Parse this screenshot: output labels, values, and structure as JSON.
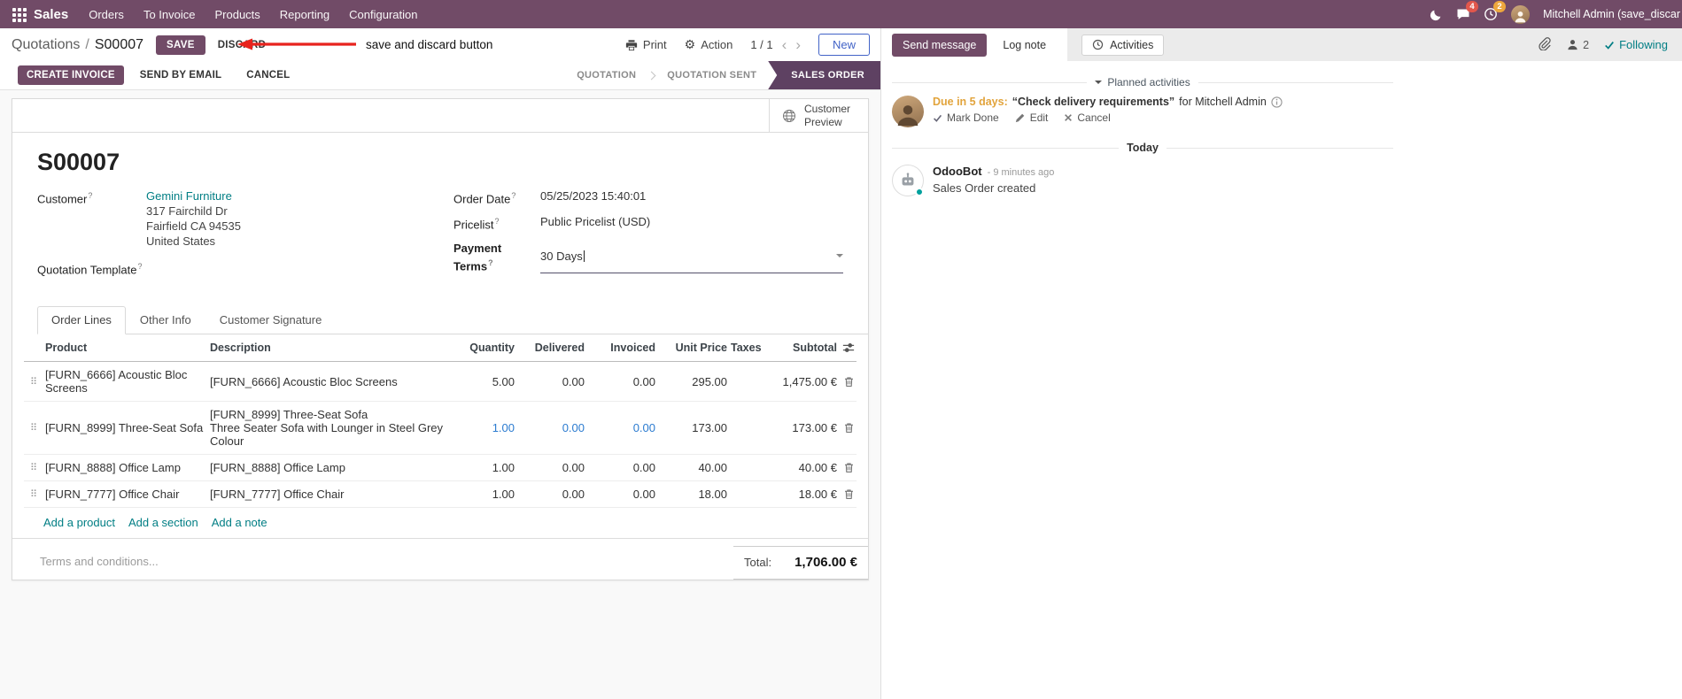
{
  "colors": {
    "brand": "#714B67",
    "link": "#017e84",
    "edited": "#2b7bd0",
    "step_active": "#5e4162",
    "due": "#e2a43c",
    "arrow": "#e8231d",
    "badge_msg": "#e2574c",
    "badge_act": "#eda73d",
    "accent_blue": "#4263c7"
  },
  "icons": {
    "drag": "⠿",
    "chevron_left": "‹",
    "chevron_right": "›",
    "gear": "⚙"
  },
  "topbar": {
    "app": "Sales",
    "menus": [
      "Orders",
      "To Invoice",
      "Products",
      "Reporting",
      "Configuration"
    ],
    "messages_badge": "4",
    "activities_badge": "2",
    "user_name": "Mitchell Admin (save_discar"
  },
  "control_panel": {
    "breadcrumb_parent": "Quotations",
    "separator": "/",
    "breadcrumb_current": "S00007",
    "save_label": "SAVE",
    "discard_label": "DISCARD",
    "annotation": "save and discard button",
    "print_label": "Print",
    "action_label": "Action",
    "pager": "1 / 1",
    "new_label": "New"
  },
  "statusbar": {
    "create_invoice": "CREATE INVOICE",
    "send_by_email": "SEND BY EMAIL",
    "cancel": "CANCEL",
    "steps": [
      "QUOTATION",
      "QUOTATION SENT",
      "SALES ORDER"
    ]
  },
  "sheet": {
    "preview_button": "Customer Preview",
    "title": "S00007",
    "help_marker": "?",
    "customer": {
      "label": "Customer",
      "name": "Gemini Furniture",
      "address": [
        "317 Fairchild Dr",
        "Fairfield CA 94535",
        "United States"
      ]
    },
    "template_label": "Quotation Template",
    "order_date": {
      "label": "Order Date",
      "value": "05/25/2023 15:40:01"
    },
    "pricelist": {
      "label": "Pricelist",
      "value": "Public Pricelist (USD)"
    },
    "payment_terms": {
      "label": "Payment Terms",
      "value": "30 Days"
    },
    "tabs": [
      "Order Lines",
      "Other Info",
      "Customer Signature"
    ],
    "table": {
      "headers": [
        "Product",
        "Description",
        "Quantity",
        "Delivered",
        "Invoiced",
        "Unit Price",
        "Taxes",
        "Subtotal"
      ],
      "rows": [
        {
          "product": "[FURN_6666] Acoustic Bloc Screens",
          "description": "[FURN_6666] Acoustic Bloc Screens",
          "description2": "",
          "quantity": "5.00",
          "delivered": "0.00",
          "invoiced": "0.00",
          "unit_price": "295.00",
          "taxes": "",
          "subtotal": "1,475.00 €"
        },
        {
          "product": "[FURN_8999] Three-Seat Sofa",
          "description": "[FURN_8999] Three-Seat Sofa",
          "description2": "Three Seater Sofa with Lounger in Steel Grey Colour",
          "quantity": "1.00",
          "delivered": "0.00",
          "invoiced": "0.00",
          "unit_price": "173.00",
          "taxes": "",
          "subtotal": "173.00 €"
        },
        {
          "product": "[FURN_8888] Office Lamp",
          "description": "[FURN_8888] Office Lamp",
          "description2": "",
          "quantity": "1.00",
          "delivered": "0.00",
          "invoiced": "0.00",
          "unit_price": "40.00",
          "taxes": "",
          "subtotal": "40.00 €"
        },
        {
          "product": "[FURN_7777] Office Chair",
          "description": "[FURN_7777] Office Chair",
          "description2": "",
          "quantity": "1.00",
          "delivered": "0.00",
          "invoiced": "0.00",
          "unit_price": "18.00",
          "taxes": "",
          "subtotal": "18.00 €"
        }
      ],
      "links": [
        "Add a product",
        "Add a section",
        "Add a note"
      ]
    },
    "terms_placeholder": "Terms and conditions...",
    "total_label": "Total:",
    "total_value": "1,706.00 €"
  },
  "chatter": {
    "send_message": "Send message",
    "log_note": "Log note",
    "activities": "Activities",
    "followers_count": "2",
    "following": "Following",
    "planned_title": "Planned activities",
    "activity": {
      "due": "Due in 5 days:",
      "summary": "“Check delivery requirements”",
      "for_text": "for Mitchell Admin",
      "mark_done": "Mark Done",
      "edit": "Edit",
      "cancel": "Cancel"
    },
    "today": "Today",
    "message": {
      "author": "OdooBot",
      "time": "- 9 minutes ago",
      "body": "Sales Order created"
    }
  }
}
